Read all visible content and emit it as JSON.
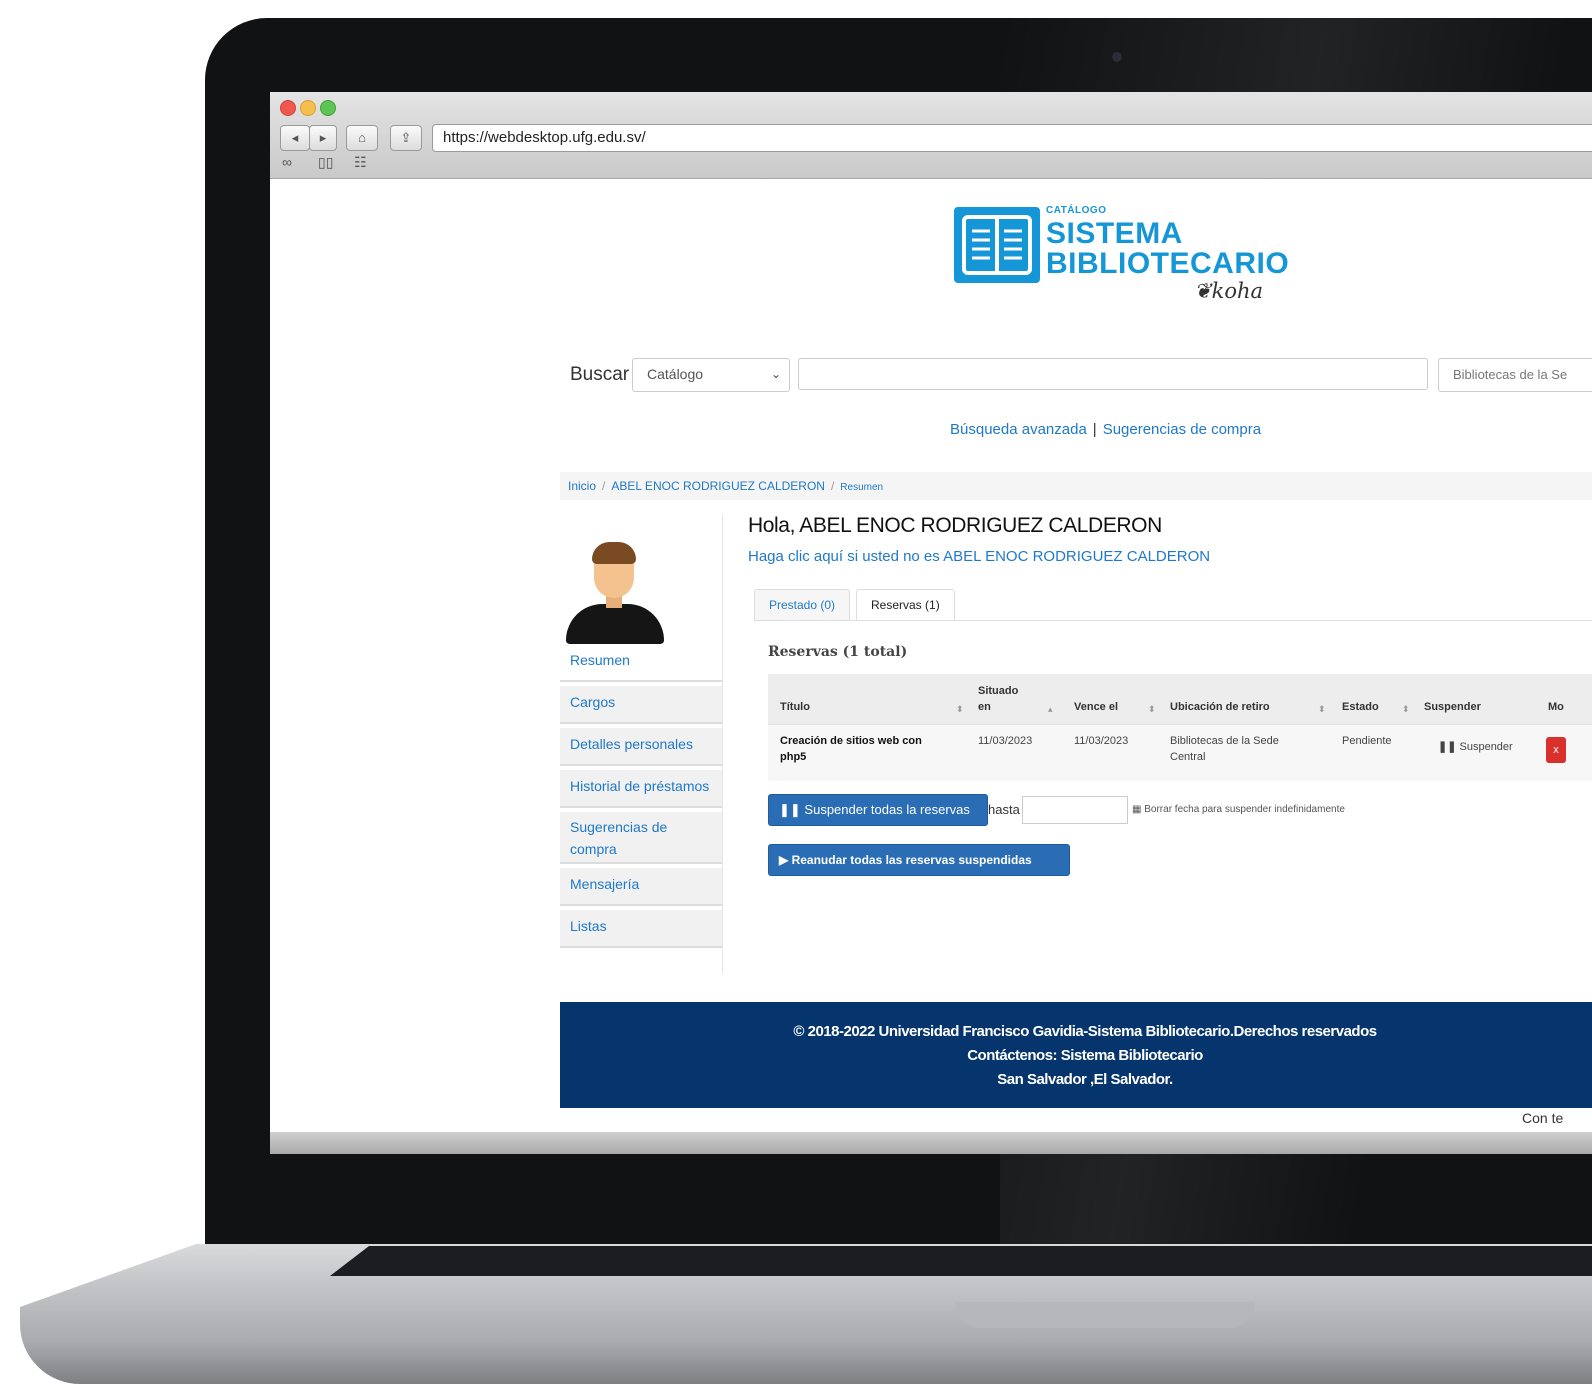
{
  "browser": {
    "url": "https://webdesktop.ufg.edu.sv/"
  },
  "header": {
    "logo_small": "CATÁLOGO",
    "logo_line1": "SISTEMA",
    "logo_line2": "BIBLIOTECARIO",
    "logo_koha": "koha"
  },
  "search": {
    "label": "Buscar",
    "type_selected": "Catálogo",
    "query": "",
    "library_selected": "Bibliotecas de la Se"
  },
  "links": {
    "advanced": "Búsqueda avanzada",
    "separator": "|",
    "suggestions": "Sugerencias de compra"
  },
  "breadcrumb": {
    "home": "Inicio",
    "separator": "/",
    "user": "ABEL ENOC RODRIGUEZ CALDERON",
    "current": "Resumen"
  },
  "sidebar": {
    "items": [
      {
        "label": "Resumen"
      },
      {
        "label": "Cargos"
      },
      {
        "label": "Detalles personales"
      },
      {
        "label": "Historial de préstamos"
      },
      {
        "label": "Sugerencias de compra"
      },
      {
        "label": "Mensajería"
      },
      {
        "label": "Listas"
      }
    ]
  },
  "main": {
    "greeting": "Hola, ABEL ENOC RODRIGUEZ CALDERON",
    "not_you": "Haga clic aquí si usted no es ABEL ENOC RODRIGUEZ CALDERON",
    "tabs": [
      {
        "label": "Prestado (0)"
      },
      {
        "label": "Reservas (1)"
      }
    ],
    "holds_title": "Reservas (1 total)",
    "columns": {
      "title": "Título",
      "placed_line1": "Situado",
      "placed_line2": "en",
      "expires": "Vence el",
      "pickup": "Ubicación de retiro",
      "status": "Estado",
      "suspend": "Suspender",
      "modify": "Mo"
    },
    "rows": [
      {
        "title_line1": "Creación de sitios web con",
        "title_line2": "php5",
        "placed": "11/03/2023",
        "expires": "11/03/2023",
        "pickup_line1": "Bibliotecas de la Sede",
        "pickup_line2": "Central",
        "status": "Pendiente",
        "suspend": "Suspender",
        "cancel": "x"
      }
    ],
    "suspend_all": "Suspender todas la reservas",
    "until": "hasta",
    "until_date": "",
    "clear_date": "Borrar fecha para suspender indefinidamente",
    "resume_all": "Reanudar todas las reservas suspendidas"
  },
  "footer": {
    "line1": "© 2018-2022 Universidad Francisco Gavidia-Sistema Bibliotecario.Derechos reservados",
    "line2": "Contáctenos: Sistema Bibliotecario",
    "line3": "San Salvador ,El Salvador."
  },
  "powered": "Con te",
  "colors": {
    "brand_blue": "#1596d6",
    "link_blue": "#1f78c8",
    "button_blue": "#2a6db5",
    "footer_navy": "#05356c",
    "cancel_red": "#d9302c"
  }
}
